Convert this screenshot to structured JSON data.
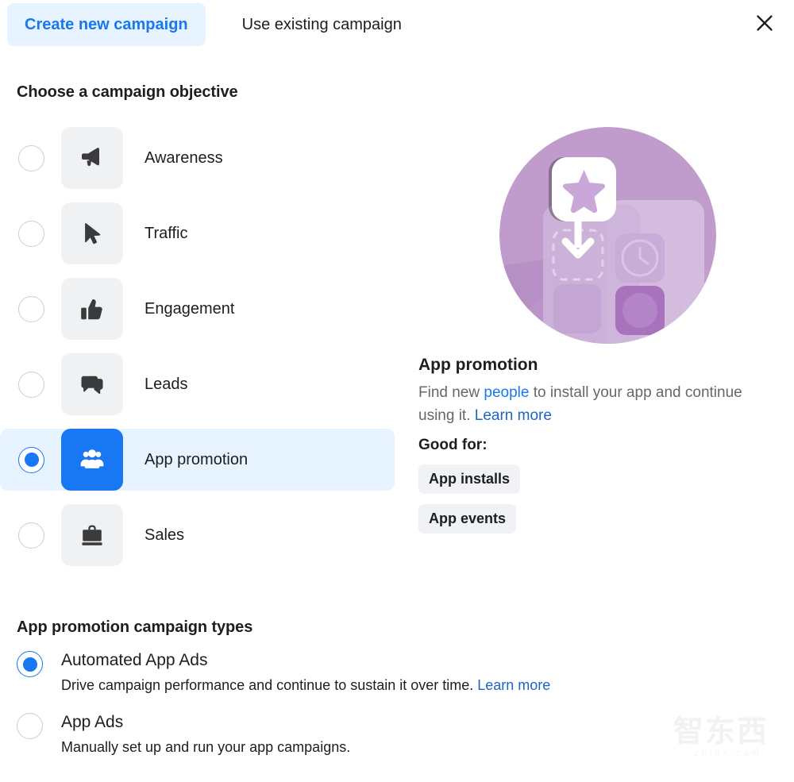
{
  "tabs": [
    {
      "label": "Create new campaign",
      "active": true,
      "name": "tab-create-new-campaign"
    },
    {
      "label": "Use existing campaign",
      "active": false,
      "name": "tab-use-existing-campaign"
    }
  ],
  "close_icon": "close-icon",
  "objective_section": {
    "title": "Choose a campaign objective",
    "items": [
      {
        "label": "Awareness",
        "icon": "megaphone-icon",
        "selected": false
      },
      {
        "label": "Traffic",
        "icon": "cursor-arrow-icon",
        "selected": false
      },
      {
        "label": "Engagement",
        "icon": "thumbs-up-icon",
        "selected": false
      },
      {
        "label": "Leads",
        "icon": "speech-bubbles-icon",
        "selected": false
      },
      {
        "label": "App promotion",
        "icon": "people-group-icon",
        "selected": true
      },
      {
        "label": "Sales",
        "icon": "briefcase-icon",
        "selected": false
      }
    ]
  },
  "detail": {
    "illustration": "app-promotion-illustration",
    "title": "App promotion",
    "desc_part1": "Find new ",
    "desc_link1": "people",
    "desc_part2": " to install your app and continue using it. ",
    "desc_link2": "Learn more",
    "good_for_label": "Good for:",
    "chips": [
      "App installs",
      "App events"
    ]
  },
  "types_section": {
    "title": "App promotion campaign types",
    "items": [
      {
        "name": "Automated App Ads",
        "desc_text": "Drive campaign performance and continue to sustain it over time. ",
        "desc_link": "Learn more",
        "selected": true
      },
      {
        "name": "App Ads",
        "desc_text": "Manually set up and run your app campaigns.",
        "desc_link": "",
        "selected": false
      }
    ]
  },
  "watermark": {
    "text": "智东西",
    "sub": "zhidx.com"
  },
  "colors": {
    "accent_blue": "#1877f2",
    "link_blue": "#1d65c1",
    "selected_row_bg": "#e7f3ff",
    "tile_gray": "#eff1f3",
    "chip_gray": "#f0f2f5",
    "text_dark": "#1c1e21",
    "text_muted": "#65676b",
    "illustration_purple": "#bf9ccc"
  }
}
